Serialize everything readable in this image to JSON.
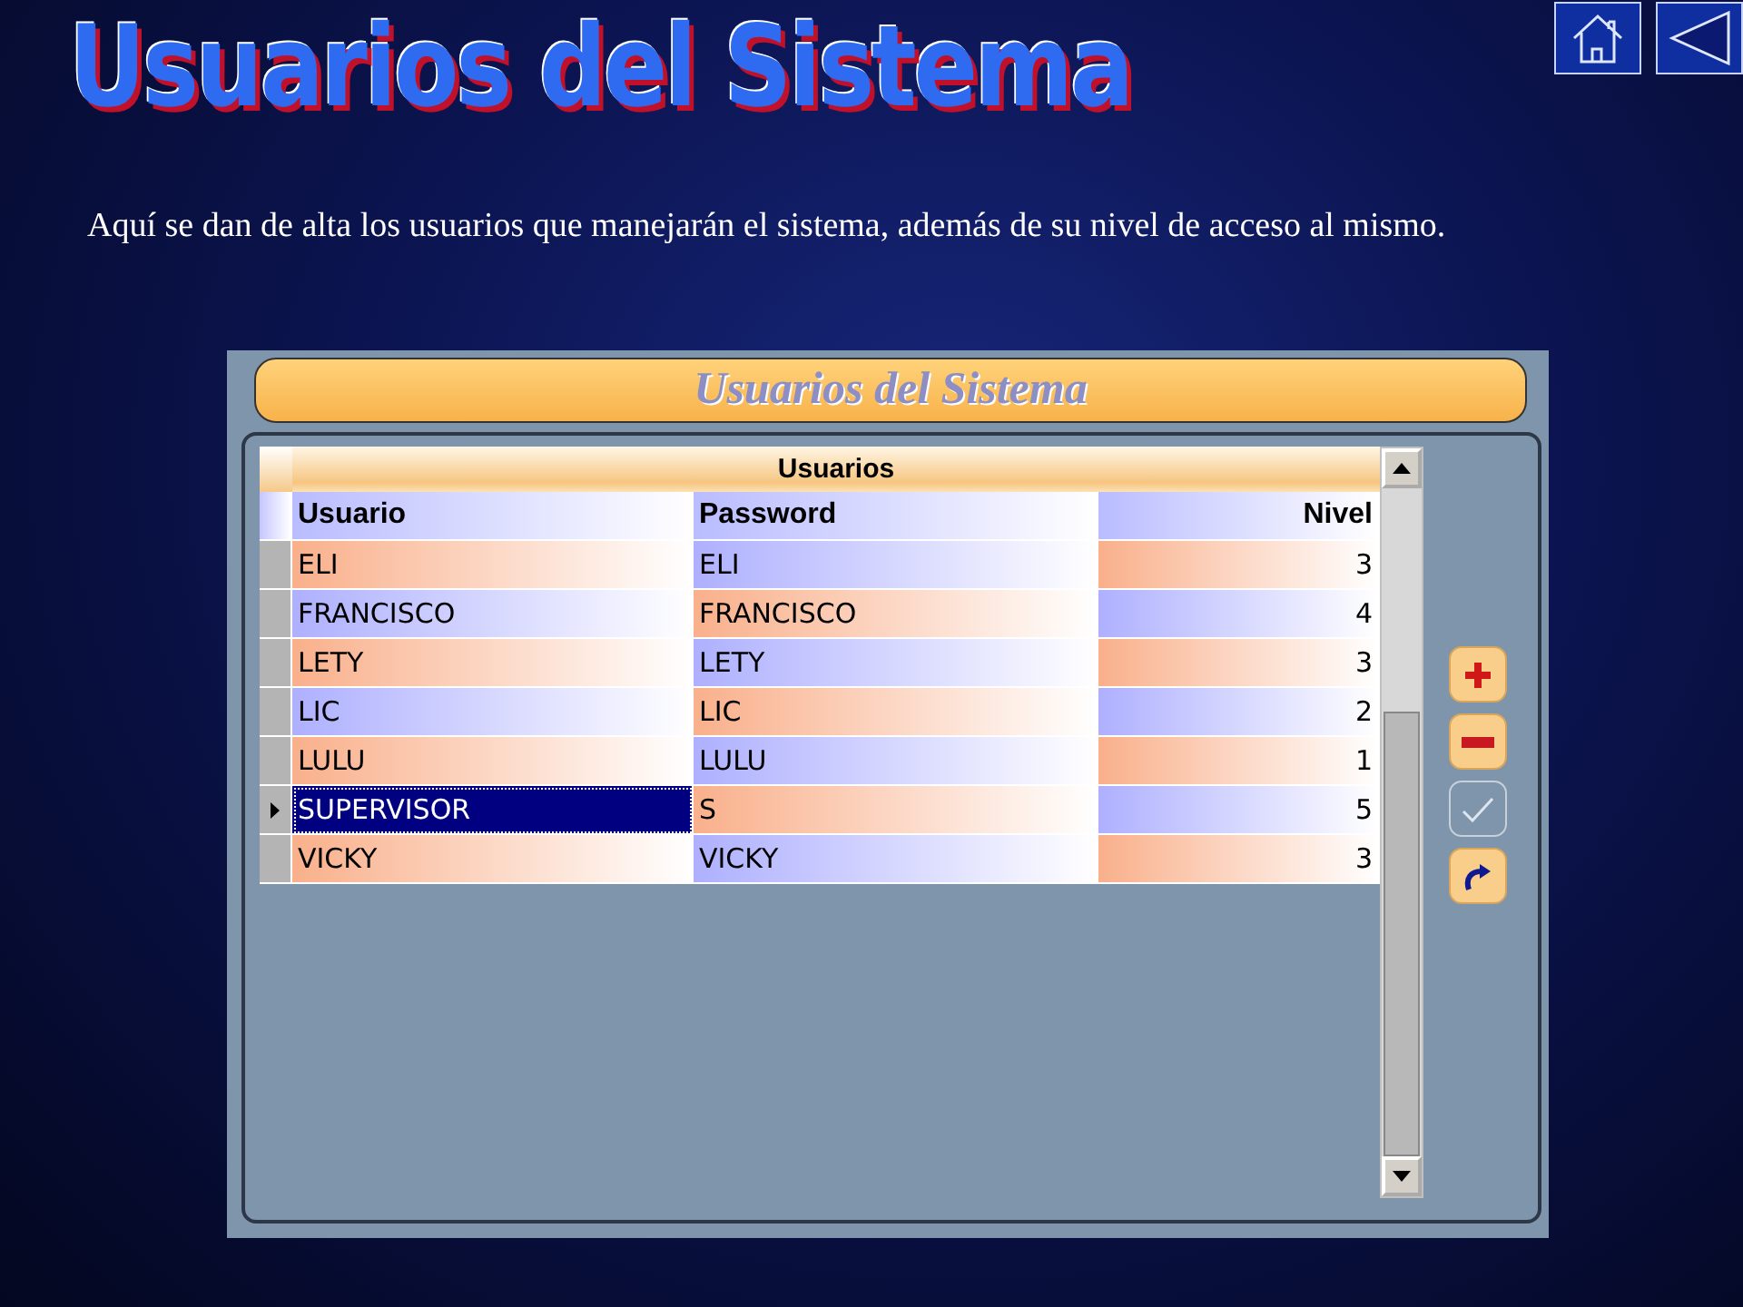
{
  "slide": {
    "title": "Usuarios del Sistema",
    "description": "Aquí se dan de alta los usuarios que manejarán el sistema, además de su nivel de acceso al mismo.",
    "nav_buttons": [
      {
        "kind": "home"
      },
      {
        "kind": "back"
      }
    ]
  },
  "app": {
    "header": "Usuarios del Sistema",
    "grid": {
      "caption": "Usuarios",
      "columns": [
        "Usuario",
        "Password",
        "Nivel"
      ],
      "rows": [
        {
          "cells": [
            "ELI",
            "ELI",
            "3"
          ],
          "selected": false
        },
        {
          "cells": [
            "FRANCISCO",
            "FRANCISCO",
            "4"
          ],
          "selected": false
        },
        {
          "cells": [
            "LETY",
            "LETY",
            "3"
          ],
          "selected": false
        },
        {
          "cells": [
            "LIC",
            "LIC",
            "2"
          ],
          "selected": false
        },
        {
          "cells": [
            "LULU",
            "LULU",
            "1"
          ],
          "selected": false
        },
        {
          "cells": [
            "SUPERVISOR",
            "S",
            "5"
          ],
          "selected": true
        },
        {
          "cells": [
            "VICKY",
            "VICKY",
            "3"
          ],
          "selected": false
        }
      ]
    },
    "tools": [
      {
        "kind": "add",
        "disabled": false
      },
      {
        "kind": "remove",
        "disabled": false
      },
      {
        "kind": "confirm",
        "disabled": true
      },
      {
        "kind": "refresh",
        "disabled": false
      }
    ]
  }
}
